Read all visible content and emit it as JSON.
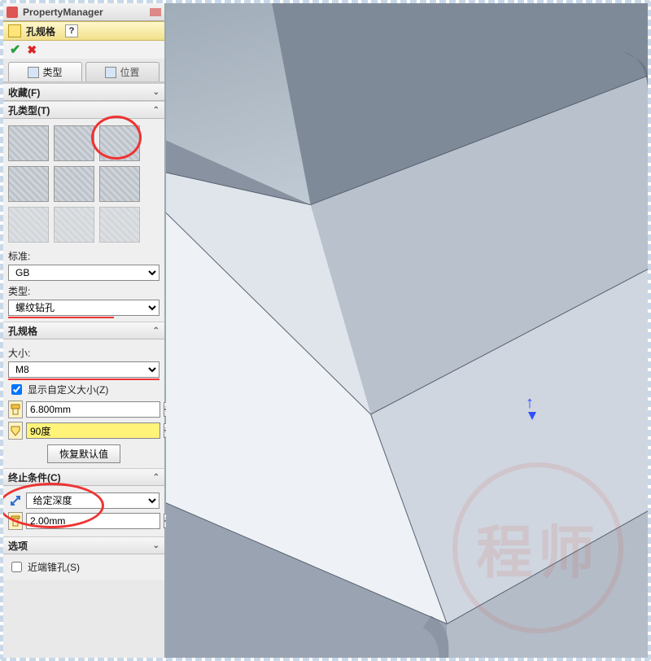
{
  "pm": {
    "title": "PropertyManager"
  },
  "feature": {
    "title": "孔规格",
    "help": "?"
  },
  "tabs": {
    "type": "类型",
    "position": "位置"
  },
  "groups": {
    "favorites": {
      "title": "收藏(F)"
    },
    "holetype": {
      "title": "孔类型(T)",
      "standard_label": "标准:",
      "standard_value": "GB",
      "type_label": "类型:",
      "type_value": "螺纹钻孔"
    },
    "holespec": {
      "title": "孔规格",
      "size_label": "大小:",
      "size_value": "M8",
      "custom_label": "显示自定义大小(Z)",
      "custom_checked": true,
      "diameter": "6.800mm",
      "angle": "90度",
      "restore_label": "恢复默认值"
    },
    "endcond": {
      "title": "终止条件(C)",
      "mode": "给定深度",
      "depth": "2.00mm"
    },
    "options": {
      "title": "选项",
      "near_cone_label": "近端锥孔(S)",
      "near_cone_checked": false
    }
  }
}
